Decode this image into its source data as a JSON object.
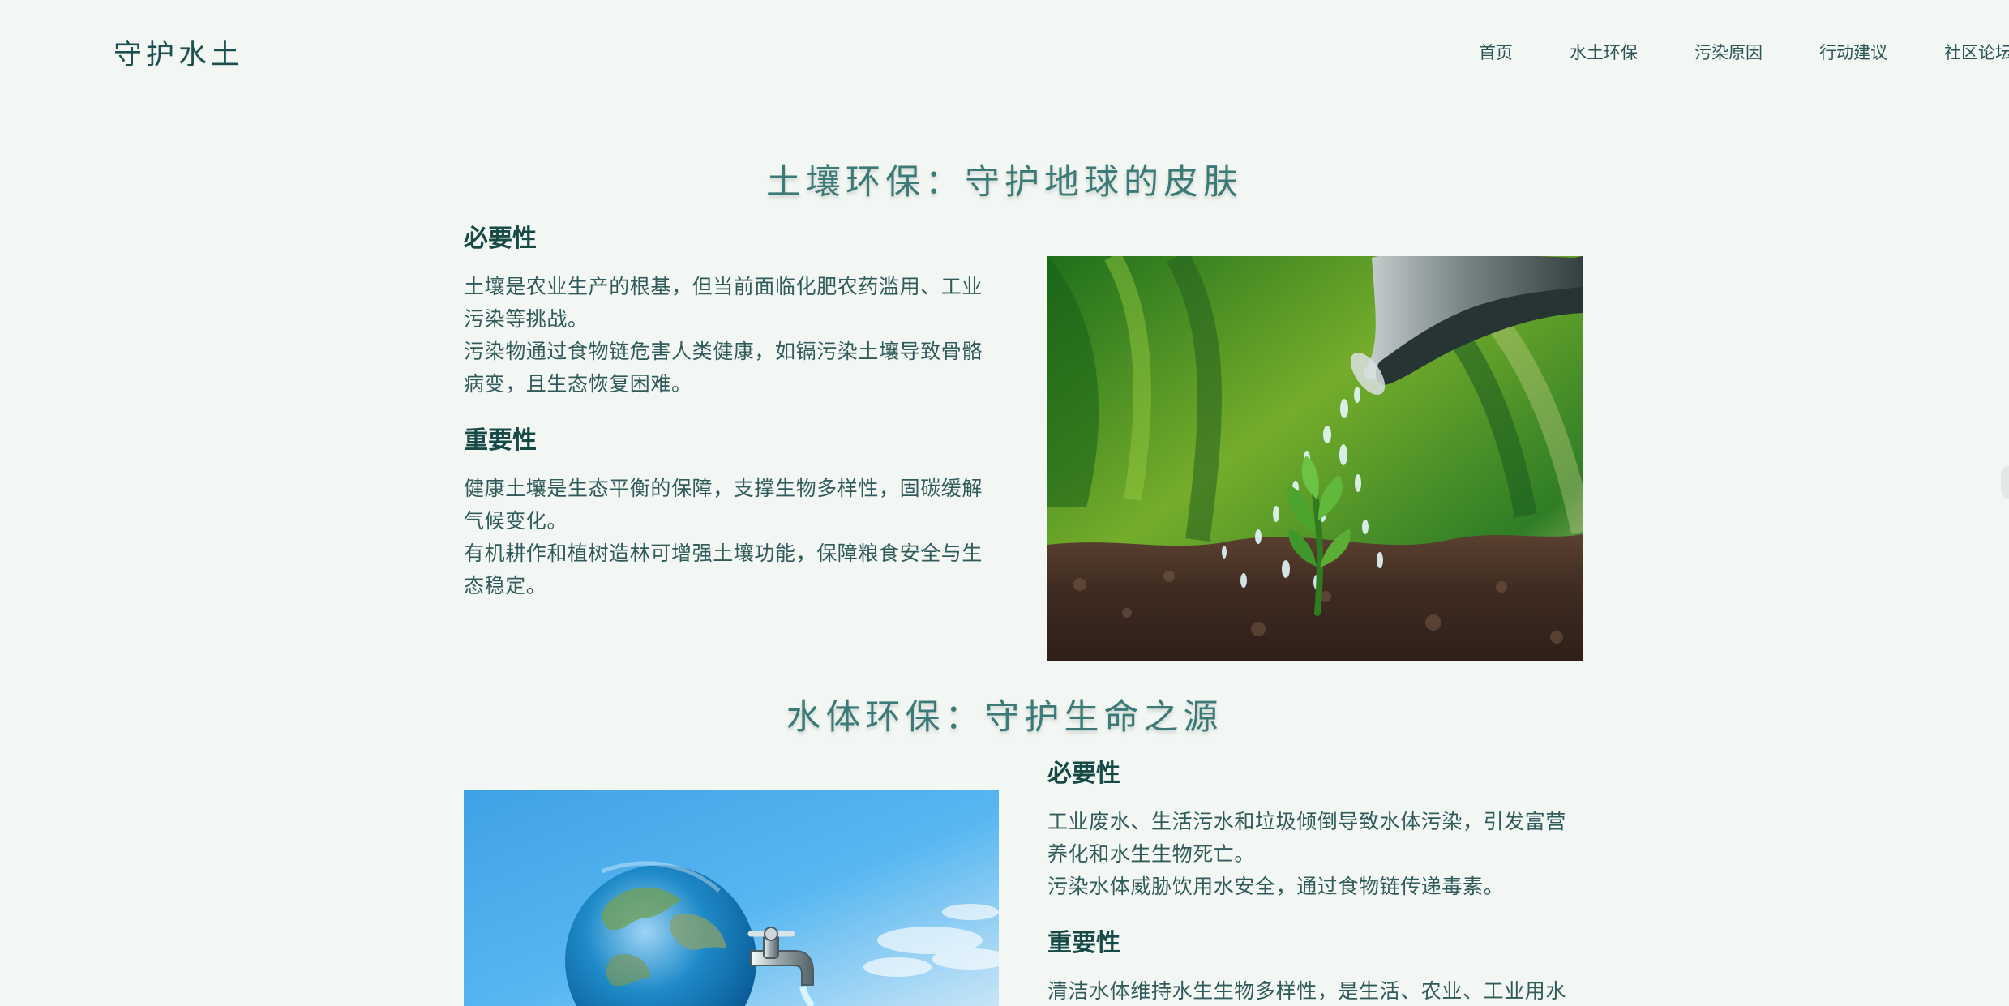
{
  "header": {
    "logo": "守护水土",
    "nav": [
      "首页",
      "水土环保",
      "污染原因",
      "行动建议",
      "社区论坛"
    ]
  },
  "soil": {
    "title": "土壤环保：守护地球的皮肤",
    "necessity_heading": "必要性",
    "necessity_paragraphs": [
      "土壤是农业生产的根基，但当前面临化肥农药滥用、工业污染等挑战。",
      "污染物通过食物链危害人类健康，如镉污染土壤导致骨骼病变，且生态恢复困难。"
    ],
    "importance_heading": "重要性",
    "importance_paragraphs": [
      "健康土壤是生态平衡的保障，支撑生物多样性，固碳缓解气候变化。",
      "有机耕作和植树造林可增强土壤功能，保障粮食安全与生态稳定。"
    ]
  },
  "water": {
    "title": "水体环保：守护生命之源",
    "necessity_heading": "必要性",
    "necessity_paragraphs": [
      "工业废水、生活污水和垃圾倾倒导致水体污染，引发富营养化和水生生物死亡。",
      "污染水体威胁饮用水安全，通过食物链传递毒素。"
    ],
    "importance_heading": "重要性",
    "importance_paragraphs": [
      "清洁水体维持水生生物多样性，是生活、农业、工业用水基"
    ]
  },
  "colors": {
    "background": "#f2f7f3",
    "text": "#315b5a",
    "heading": "#174947",
    "section_title": "#3b7a76"
  },
  "icons": {
    "soil_image": "watering-can-sprout-image",
    "water_image": "earth-faucet-image"
  }
}
